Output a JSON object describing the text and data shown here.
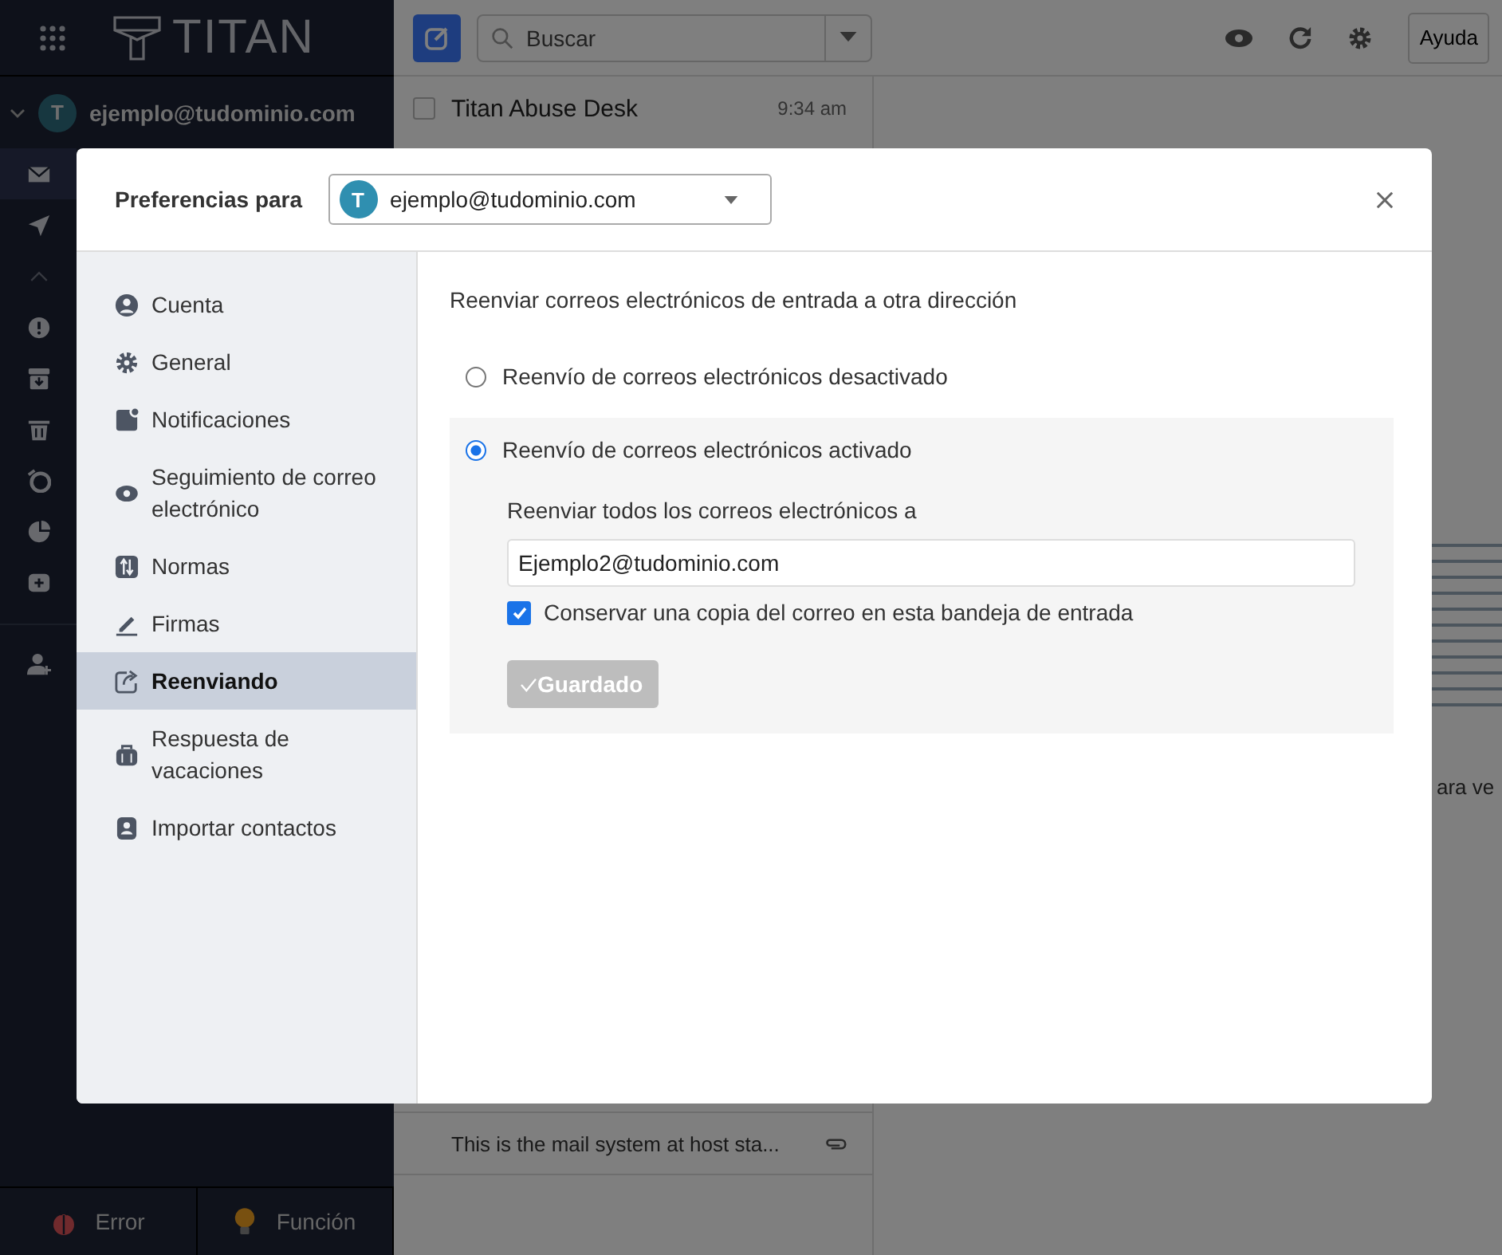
{
  "app": {
    "logo": "TITAN",
    "account": {
      "avatar": "T",
      "email": "ejemplo@tudominio.com",
      "expanded": true
    },
    "search": {
      "placeholder": "Buscar"
    },
    "help_button": "Ayuda",
    "rail": [
      {
        "kind": "mail",
        "selected": true
      },
      {
        "kind": "send",
        "selected": false
      },
      {
        "kind": "collapse",
        "selected": false
      },
      {
        "kind": "alert",
        "selected": false
      },
      {
        "kind": "archive",
        "selected": false
      },
      {
        "kind": "trash",
        "selected": false
      },
      {
        "kind": "snooze",
        "selected": false
      },
      {
        "kind": "pie",
        "selected": false
      },
      {
        "kind": "add",
        "selected": false
      },
      {
        "kind": "person-add",
        "selected": false
      }
    ],
    "footer_buttons": [
      {
        "kind": "bug",
        "label": "Error"
      },
      {
        "kind": "bulb",
        "label": "Función"
      }
    ]
  },
  "mail_list": {
    "items": [
      {
        "sender": "Titan Abuse Desk",
        "time": "9:34 am",
        "checked": false
      }
    ],
    "preview": "This is the mail system at host sta..."
  },
  "reading_pane": {
    "text": "ara ve"
  },
  "dialog": {
    "title": "Preferencias para",
    "account": {
      "avatar": "T",
      "email": "ejemplo@tudominio.com"
    },
    "nav": [
      {
        "kind": "user",
        "label": "Cuenta",
        "selected": false
      },
      {
        "kind": "gear",
        "label": "General",
        "selected": false
      },
      {
        "kind": "bell",
        "label": "Notificaciones",
        "selected": false
      },
      {
        "kind": "eye",
        "label": "Seguimiento de correo electrónico",
        "selected": false
      },
      {
        "kind": "rules",
        "label": "Normas",
        "selected": false
      },
      {
        "kind": "pen",
        "label": "Firmas",
        "selected": false
      },
      {
        "kind": "forward",
        "label": "Reenviando",
        "selected": true
      },
      {
        "kind": "suitcase",
        "label": "Respuesta de vacaciones",
        "selected": false
      },
      {
        "kind": "contact",
        "label": "Importar contactos",
        "selected": false
      }
    ],
    "heading": "Reenviar correos electrónicos de entrada a otra dirección",
    "options": [
      {
        "label": "Reenvío de correos electrónicos desactivado",
        "selected": false
      },
      {
        "label": "Reenvío de correos electrónicos activado",
        "selected": true
      }
    ],
    "forward_label": "Reenviar todos los correos electrónicos a",
    "forward_address": "Ejemplo2@tudominio.com",
    "keep_copy": {
      "label": "Conservar una copia del correo en esta bandeja de entrada",
      "checked": true
    },
    "save_button": {
      "label": "Guardado",
      "disabled": true
    }
  }
}
